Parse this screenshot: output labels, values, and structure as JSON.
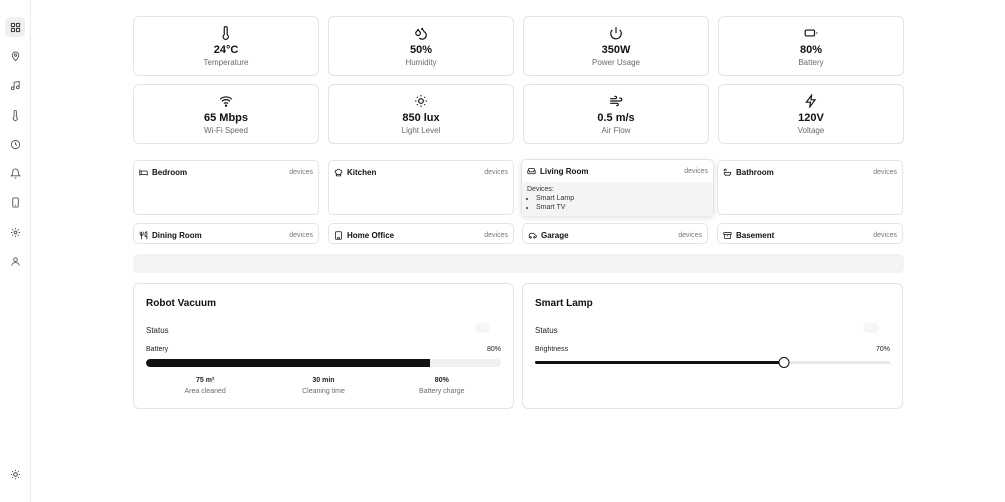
{
  "sidebar": {
    "icons": [
      "dashboard-icon",
      "map-pin-icon",
      "music-icon",
      "thermometer-icon",
      "clock-icon",
      "bell-icon",
      "phone-icon",
      "settings-icon",
      "user-icon"
    ],
    "bottom_icon": "sun-icon"
  },
  "stats": [
    {
      "icon": "thermometer-icon",
      "value": "24°C",
      "label": "Temperature"
    },
    {
      "icon": "droplets-icon",
      "value": "50%",
      "label": "Humidity"
    },
    {
      "icon": "power-icon",
      "value": "350W",
      "label": "Power Usage"
    },
    {
      "icon": "battery-icon",
      "value": "80%",
      "label": "Battery"
    },
    {
      "icon": "wifi-icon",
      "value": "65 Mbps",
      "label": "Wi-Fi Speed"
    },
    {
      "icon": "sun-icon",
      "value": "850 lux",
      "label": "Light Level"
    },
    {
      "icon": "wind-icon",
      "value": "0.5 m/s",
      "label": "Air Flow"
    },
    {
      "icon": "zap-icon",
      "value": "120V",
      "label": "Voltage"
    }
  ],
  "rooms": [
    {
      "icon": "bed-icon",
      "name": "Bedroom",
      "devices_label": "devices"
    },
    {
      "icon": "chef-hat-icon",
      "name": "Kitchen",
      "devices_label": "devices"
    },
    {
      "icon": "sofa-icon",
      "name": "Living Room",
      "devices_label": "devices",
      "dropdown": {
        "title": "Devices:",
        "items": [
          "Smart Lamp",
          "Smart TV"
        ]
      }
    },
    {
      "icon": "bath-icon",
      "name": "Bathroom",
      "devices_label": "devices"
    },
    {
      "icon": "utensils-icon",
      "name": "Dining Room",
      "devices_label": "devices"
    },
    {
      "icon": "building-icon",
      "name": "Home Office",
      "devices_label": "devices"
    },
    {
      "icon": "car-icon",
      "name": "Garage",
      "devices_label": "devices"
    },
    {
      "icon": "archive-icon",
      "name": "Basement",
      "devices_label": "devices"
    }
  ],
  "vacuum": {
    "title": "Robot Vacuum",
    "status_label": "Status",
    "battery_label": "Battery",
    "battery_value": "80%",
    "battery_fraction": 0.8,
    "stats": [
      {
        "value": "75 m²",
        "label": "Area cleaned"
      },
      {
        "value": "30 min",
        "label": "Cleaning time"
      },
      {
        "value": "80%",
        "label": "Battery charge"
      }
    ]
  },
  "lamp": {
    "title": "Smart Lamp",
    "status_label": "Status",
    "brightness_label": "Brightness",
    "brightness_value": "70%",
    "brightness_fraction": 0.7
  }
}
